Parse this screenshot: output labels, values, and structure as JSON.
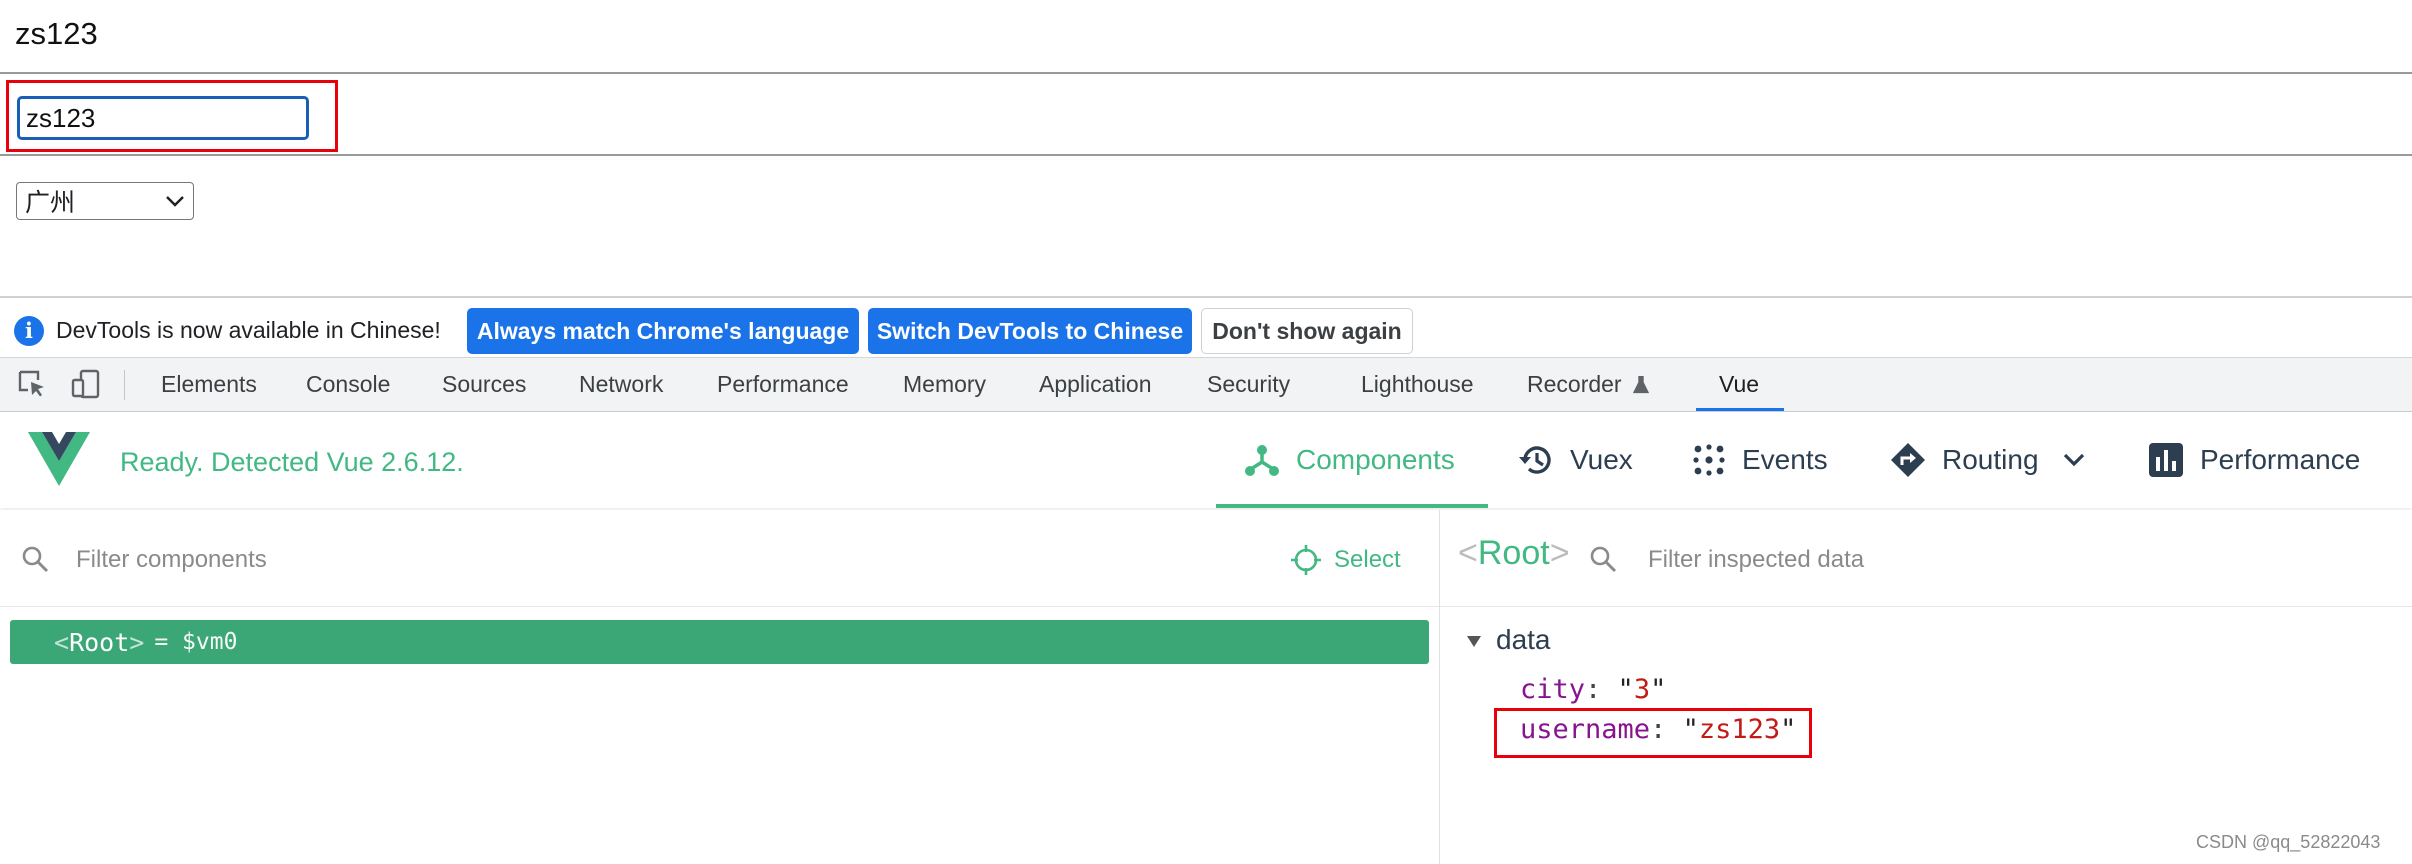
{
  "page": {
    "username_text": "zs123",
    "username_input_value": "zs123",
    "city_select_value": "广州"
  },
  "infobar": {
    "message": "DevTools is now available in Chinese!",
    "btn_match": "Always match Chrome's language",
    "btn_switch": "Switch DevTools to Chinese",
    "btn_dismiss": "Don't show again"
  },
  "devtools_tabs": [
    "Elements",
    "Console",
    "Sources",
    "Network",
    "Performance",
    "Memory",
    "Application",
    "Security",
    "Lighthouse",
    "Recorder",
    "Vue"
  ],
  "vue": {
    "status": "Ready. Detected Vue 2.6.12.",
    "nav": {
      "components": "Components",
      "vuex": "Vuex",
      "events": "Events",
      "routing": "Routing",
      "performance": "Performance"
    },
    "left": {
      "filter_placeholder": "Filter components",
      "select_label": "Select",
      "root_open": "<",
      "root_name": "Root",
      "root_close": ">",
      "root_ref": "= $vm0"
    },
    "right": {
      "root_open": "<",
      "root_name": "Root",
      "root_close": ">",
      "filter_placeholder": "Filter inspected data",
      "section": "data",
      "props": [
        {
          "key": "city",
          "value": "3"
        },
        {
          "key": "username",
          "value": "zs123"
        }
      ]
    }
  },
  "watermark": "CSDN @qq_52822043",
  "colors": {
    "vue_green": "#42b883",
    "chrome_blue": "#1a73e8",
    "highlight_red": "#e8000b"
  }
}
